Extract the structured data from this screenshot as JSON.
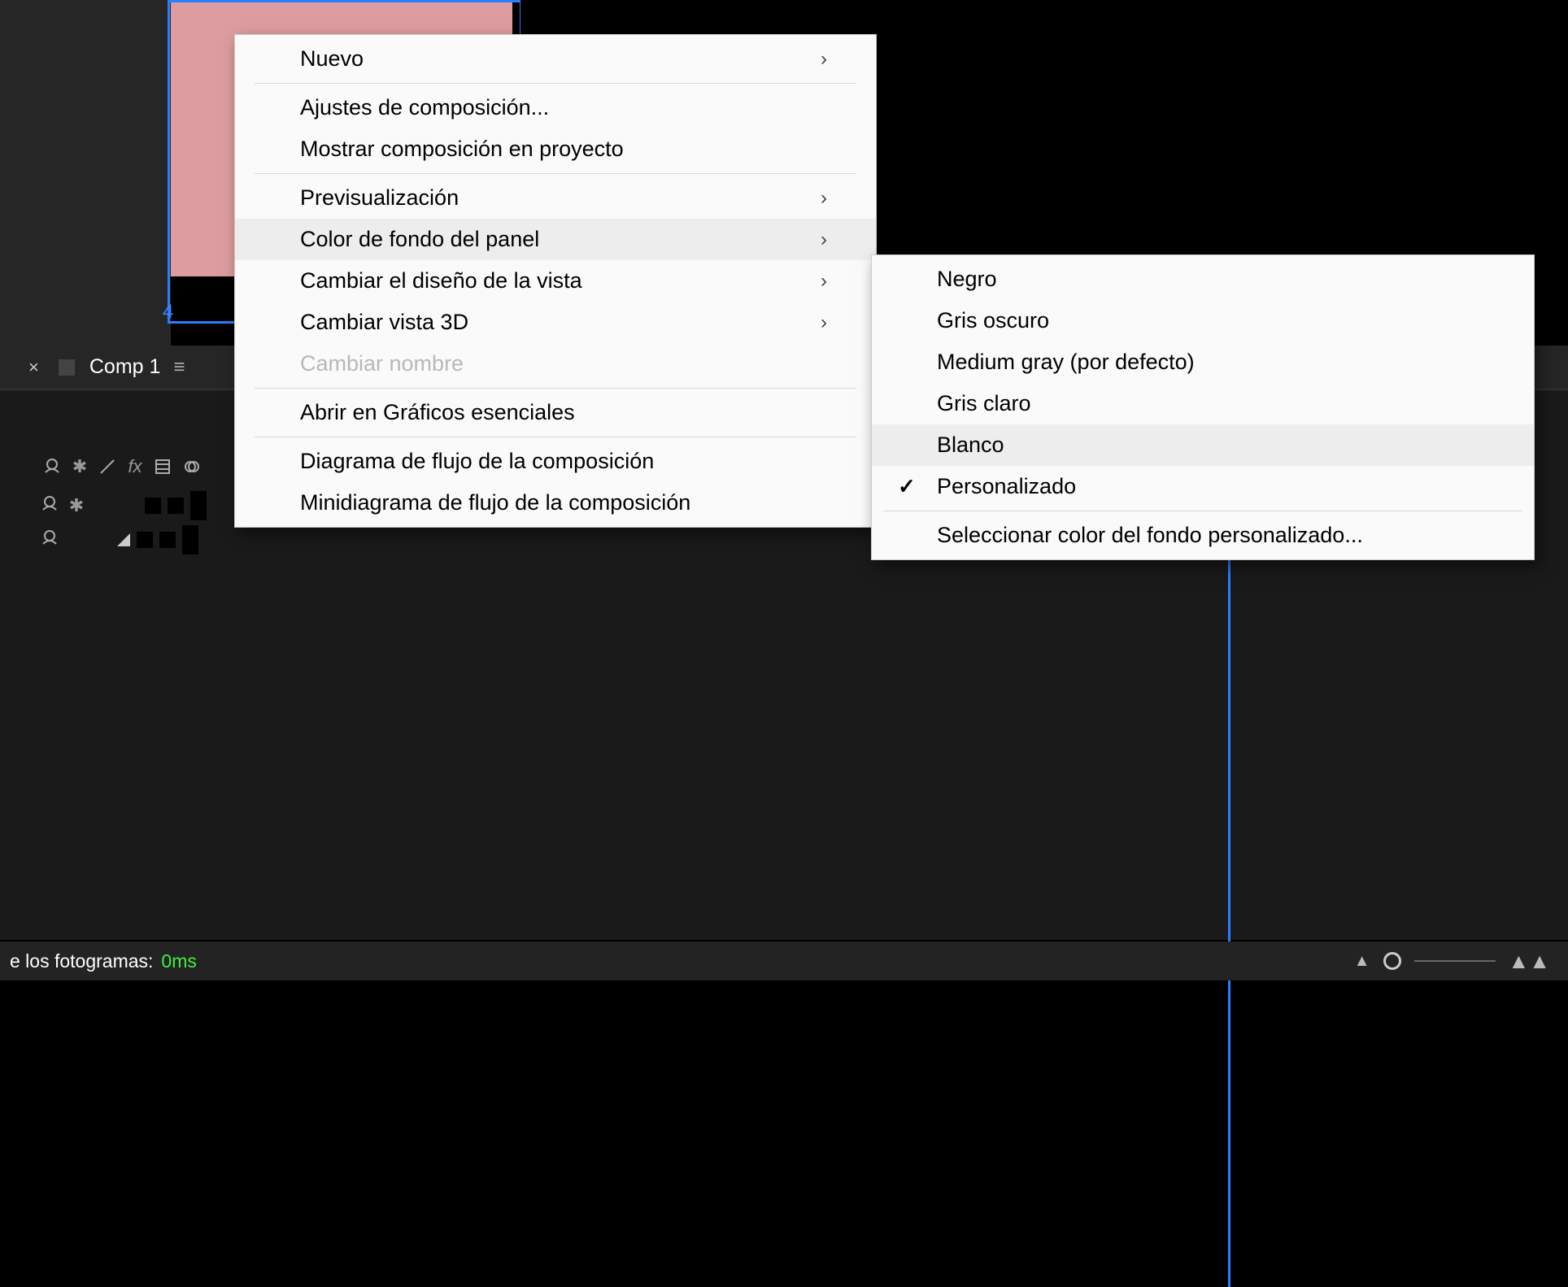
{
  "canvas": {
    "marker_text": "4"
  },
  "timeline": {
    "tab_close": "×",
    "tab_name": "Comp 1",
    "tab_menu_icon": "≡"
  },
  "status": {
    "label_prefix": "e los fotogramas:",
    "value": "0ms"
  },
  "menu": {
    "items": [
      {
        "label": "Nuevo",
        "has_sub": true
      },
      {
        "sep": true
      },
      {
        "label": "Ajustes de composición..."
      },
      {
        "label": "Mostrar composición en proyecto"
      },
      {
        "sep": true
      },
      {
        "label": "Previsualización",
        "has_sub": true
      },
      {
        "label": "Color de fondo del panel",
        "has_sub": true,
        "highlighted": true
      },
      {
        "label": "Cambiar el diseño de la vista",
        "has_sub": true
      },
      {
        "label": "Cambiar vista 3D",
        "has_sub": true
      },
      {
        "label": "Cambiar nombre",
        "disabled": true
      },
      {
        "sep": true
      },
      {
        "label": "Abrir en Gráficos esenciales"
      },
      {
        "sep": true
      },
      {
        "label": "Diagrama de flujo de la composición"
      },
      {
        "label": "Minidiagrama de flujo de la composición"
      }
    ]
  },
  "submenu": {
    "items": [
      {
        "label": "Negro"
      },
      {
        "label": "Gris oscuro"
      },
      {
        "label": "Medium gray (por defecto)"
      },
      {
        "label": "Gris claro"
      },
      {
        "label": "Blanco",
        "highlighted": true
      },
      {
        "label": "Personalizado",
        "checked": true
      },
      {
        "sep": true
      },
      {
        "label": "Seleccionar color del fondo personalizado..."
      }
    ]
  }
}
